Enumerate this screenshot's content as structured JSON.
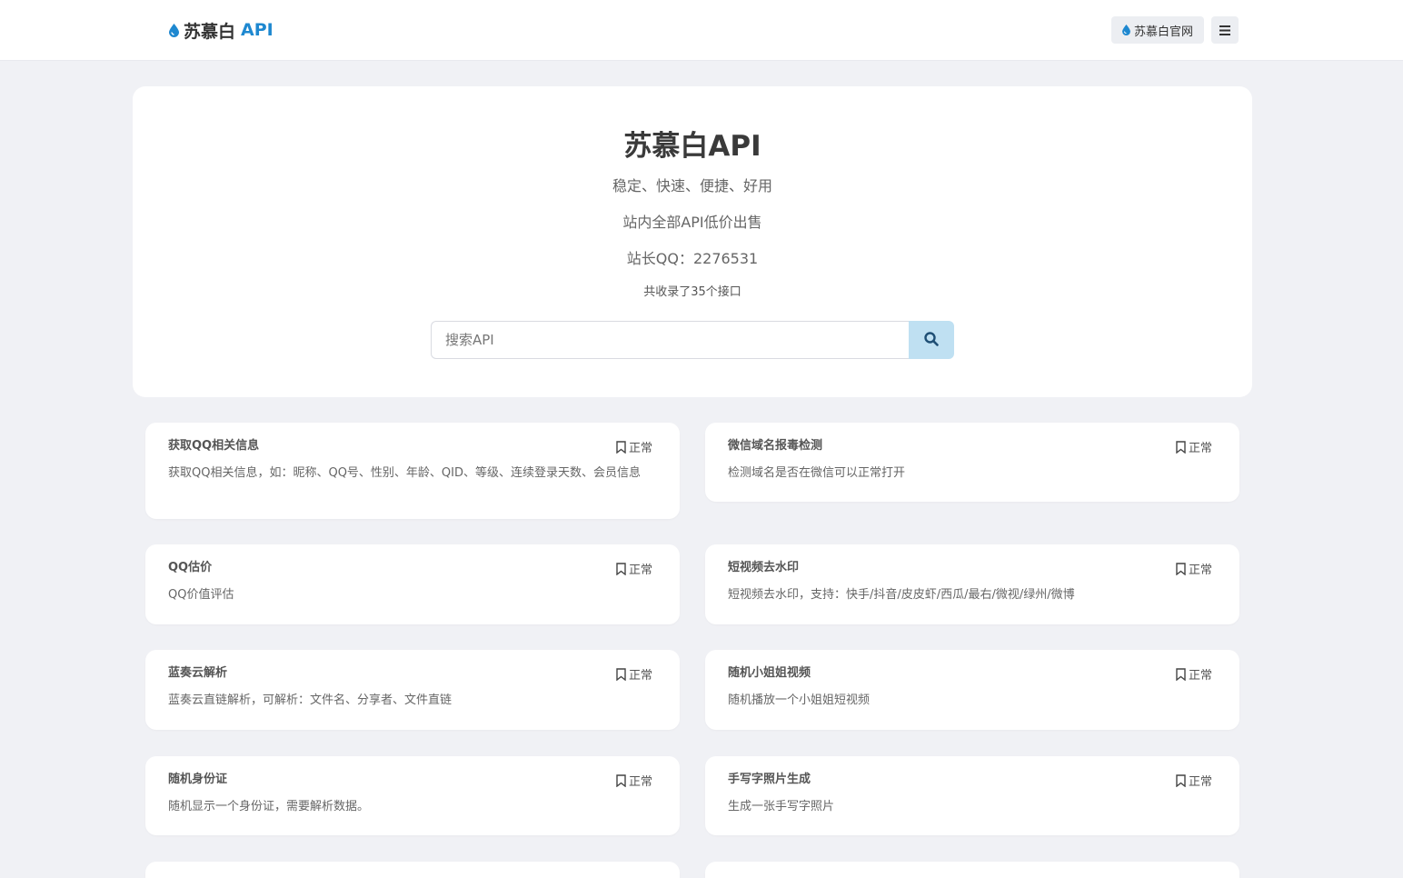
{
  "header": {
    "brand_name": "苏慕白",
    "brand_accent": "API",
    "official_site_label": "苏慕白官网",
    "menu_icon": "hamburger-icon",
    "accent_color": "#1e88d0"
  },
  "hero": {
    "title": "苏慕白API",
    "tagline": "稳定、快速、便捷、好用",
    "promo": "站内全部API低价出售",
    "contact": "站长QQ：2276531",
    "count_text": "共收录了35个接口",
    "search": {
      "placeholder": "搜索API",
      "button_icon": "search-icon"
    }
  },
  "apis": [
    {
      "title": "获取QQ相关信息",
      "status": "正常",
      "desc": "获取QQ相关信息，如：昵称、QQ号、性别、年龄、QID、等级、连续登录天数、会员信息"
    },
    {
      "title": "微信域名报毒检测",
      "status": "正常",
      "desc": "检测域名是否在微信可以正常打开"
    },
    {
      "title": "QQ估价",
      "status": "正常",
      "desc": "QQ价值评估"
    },
    {
      "title": "短视频去水印",
      "status": "正常",
      "desc": "短视频去水印，支持：快手/抖音/皮皮虾/西瓜/最右/微视/绿州/微博"
    },
    {
      "title": "蓝奏云解析",
      "status": "正常",
      "desc": "蓝奏云直链解析，可解析：文件名、分享者、文件直链"
    },
    {
      "title": "随机小姐姐视频",
      "status": "正常",
      "desc": "随机播放一个小姐姐短视频"
    },
    {
      "title": "随机身份证",
      "status": "正常",
      "desc": "随机显示一个身份证，需要解析数据。"
    },
    {
      "title": "手写字照片生成",
      "status": "正常",
      "desc": "生成一张手写字照片"
    }
  ]
}
